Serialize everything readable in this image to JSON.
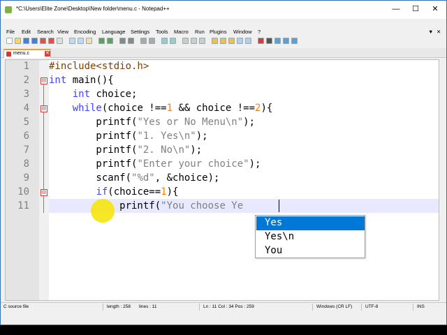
{
  "window": {
    "title": "*C:\\Users\\Elite Zone\\Desktop\\New folder\\menu.c - Notepad++",
    "controls": [
      "—",
      "☐",
      "✕"
    ],
    "extra_controls": [
      "▼",
      "✕"
    ]
  },
  "menubar": [
    "File",
    "Edit",
    "Search",
    "View",
    "Encoding",
    "Language",
    "Settings",
    "Tools",
    "Macro",
    "Run",
    "Plugins",
    "Window",
    "?"
  ],
  "tab": {
    "label": "menu.c",
    "close": "✕"
  },
  "editor": {
    "line_numbers": [
      "1",
      "2",
      "3",
      "4",
      "5",
      "6",
      "7",
      "8",
      "9",
      "10",
      "11"
    ],
    "fold_marker": "⊟",
    "lines": [
      [
        {
          "t": "#include<stdio.h>",
          "c": "p"
        }
      ],
      [
        {
          "t": "int",
          "c": "k"
        },
        {
          "t": " main(){",
          "c": ""
        }
      ],
      [
        {
          "t": "    ",
          "c": ""
        },
        {
          "t": "int",
          "c": "k"
        },
        {
          "t": " choice;",
          "c": ""
        }
      ],
      [
        {
          "t": "    ",
          "c": ""
        },
        {
          "t": "while",
          "c": "k"
        },
        {
          "t": "(choice !==",
          "c": ""
        },
        {
          "t": "1",
          "c": "n"
        },
        {
          "t": " && choice !==",
          "c": ""
        },
        {
          "t": "2",
          "c": "n"
        },
        {
          "t": "){",
          "c": ""
        }
      ],
      [
        {
          "t": "        printf(",
          "c": ""
        },
        {
          "t": "\"Yes or No Menu\\n\"",
          "c": "s"
        },
        {
          "t": ");",
          "c": ""
        }
      ],
      [
        {
          "t": "        printf(",
          "c": ""
        },
        {
          "t": "\"1. Yes\\n\"",
          "c": "s"
        },
        {
          "t": ");",
          "c": ""
        }
      ],
      [
        {
          "t": "        printf(",
          "c": ""
        },
        {
          "t": "\"2. No\\n\"",
          "c": "s"
        },
        {
          "t": ");",
          "c": ""
        }
      ],
      [
        {
          "t": "        printf(",
          "c": ""
        },
        {
          "t": "\"Enter your choice\"",
          "c": "s"
        },
        {
          "t": ");",
          "c": ""
        }
      ],
      [
        {
          "t": "        scanf(",
          "c": ""
        },
        {
          "t": "\"%d\"",
          "c": "s"
        },
        {
          "t": ", &choice);",
          "c": ""
        }
      ],
      [
        {
          "t": "        ",
          "c": ""
        },
        {
          "t": "if",
          "c": "k"
        },
        {
          "t": "(choice==",
          "c": ""
        },
        {
          "t": "1",
          "c": "n"
        },
        {
          "t": "){",
          "c": ""
        }
      ],
      [
        {
          "t": "            printf(",
          "c": ""
        },
        {
          "t": "\"You choose Ye",
          "c": "s"
        }
      ]
    ]
  },
  "autocomplete": {
    "items": [
      "Yes",
      "Yes\\n",
      "You"
    ],
    "selected_index": 0
  },
  "statusbar": {
    "file_type": "C source file",
    "length": "length : 258",
    "lines": "lines : 11",
    "position": "Ln : 11    Col : 34    Pos : 259",
    "eol": "Windows (CR LF)",
    "encoding": "UTF-8",
    "mode": "INS"
  },
  "colors": {
    "keyword": "#4040ff",
    "string": "#808080",
    "number": "#ff8000",
    "preprocessor": "#804000",
    "selection": "#0078d7",
    "caret_line": "#e8e8ff"
  }
}
